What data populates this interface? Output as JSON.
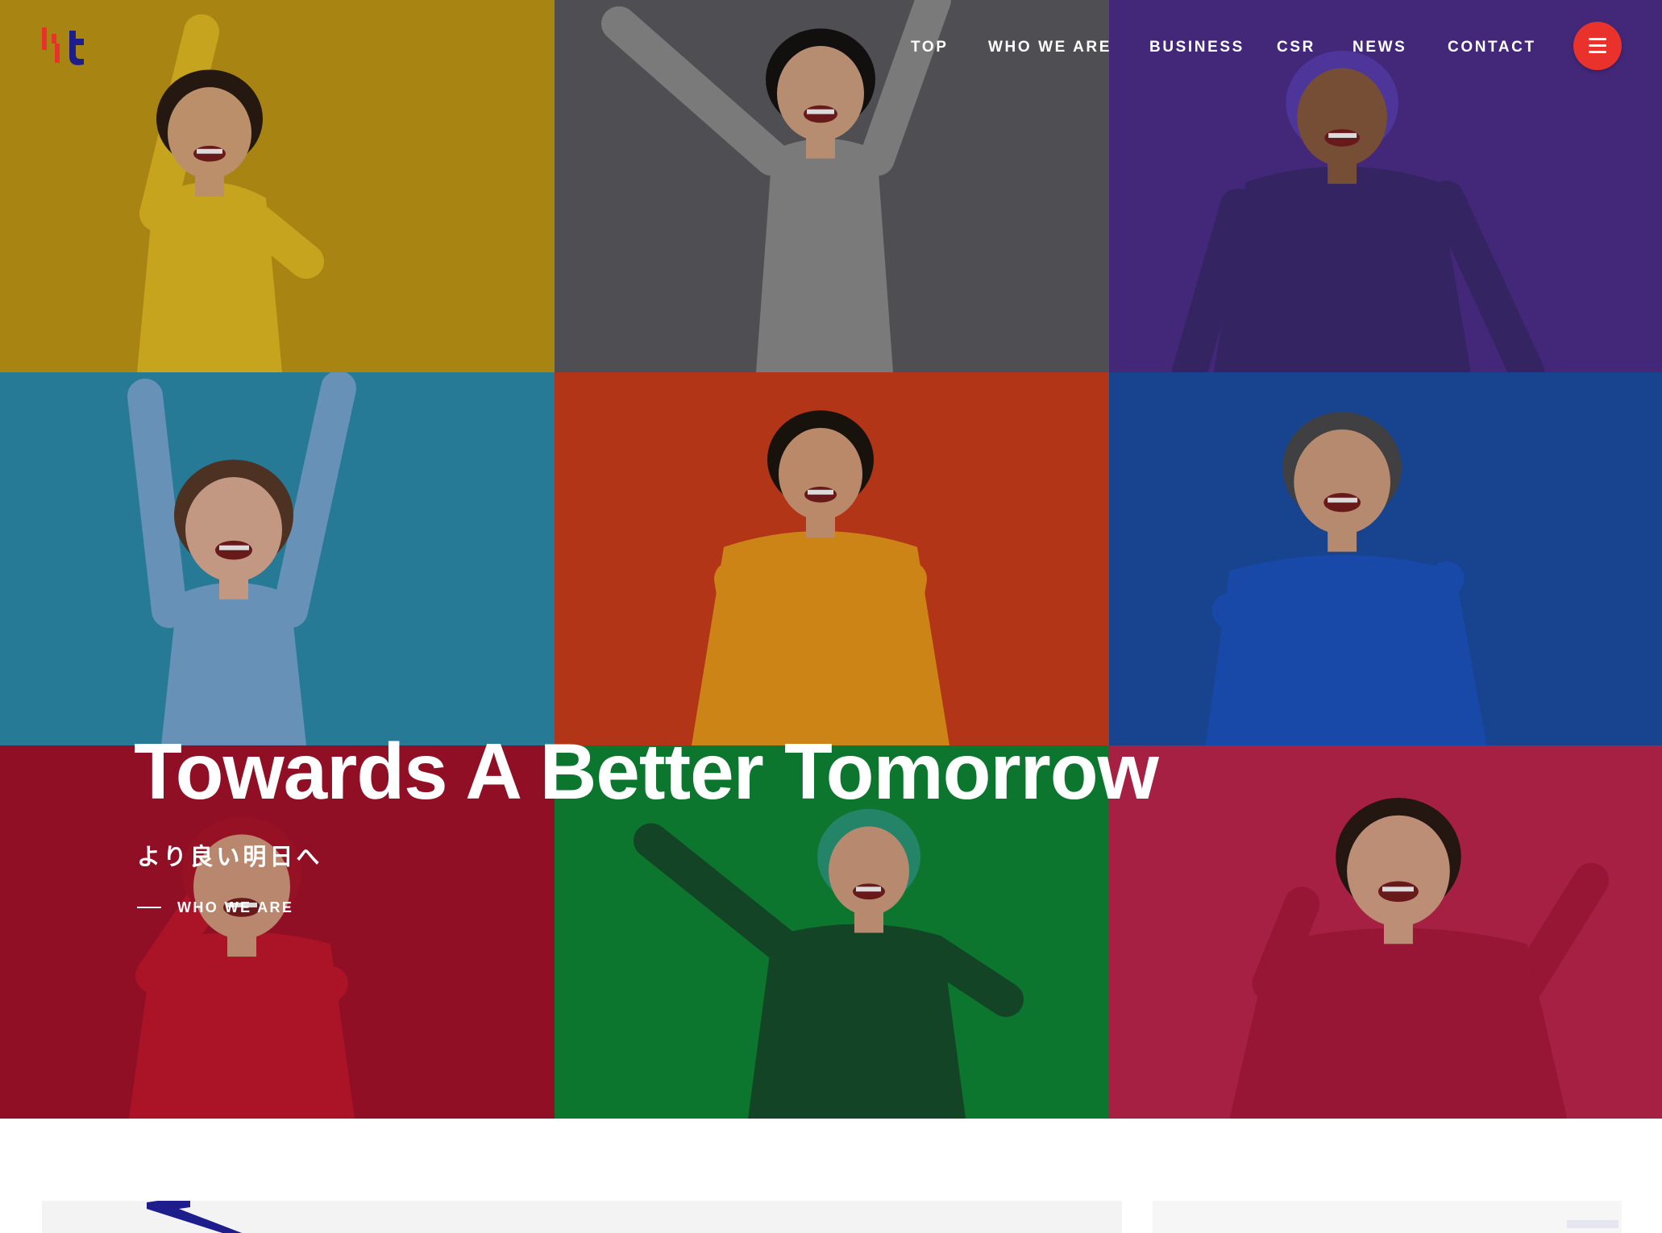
{
  "brand": {
    "logo_name": "company-logo"
  },
  "nav": {
    "items": [
      {
        "id": "top",
        "label": "TOP"
      },
      {
        "id": "who",
        "label": "WHO WE ARE"
      },
      {
        "id": "business",
        "label": "BUSINESS"
      },
      {
        "id": "csr",
        "label": "CSR"
      },
      {
        "id": "news",
        "label": "NEWS"
      },
      {
        "id": "contact",
        "label": "CONTACT"
      }
    ],
    "menu_icon": "hamburger-icon"
  },
  "hero": {
    "title": "Towards A Better Tomorrow",
    "subtitle": "より良い明日へ",
    "link_label": "WHO WE ARE",
    "tiles": [
      {
        "name": "child-yellow",
        "bg": "#c49a16",
        "figure": "#e8bf22",
        "skin": "#d9a77b",
        "hair": "#2a1c14"
      },
      {
        "name": "woman-gray",
        "bg": "#5d5d61",
        "figure": "#8e8e90",
        "skin": "#d6a585",
        "hair": "#151212"
      },
      {
        "name": "man-purple",
        "bg": "#4f2f8e",
        "figure": "#3d2c73",
        "skin": "#8a5b3e",
        "hair": "#5a3eb4"
      },
      {
        "name": "woman-teal",
        "bg": "#2d8fae",
        "figure": "#79a9d6",
        "skin": "#e3b299",
        "hair": "#5a3a28"
      },
      {
        "name": "man-orange",
        "bg": "#cf3e1a",
        "figure": "#ee9a1b",
        "skin": "#d9a07c",
        "hair": "#1c1510"
      },
      {
        "name": "man-blue",
        "bg": "#1c4ea6",
        "figure": "#1d55c4",
        "skin": "#d3a182",
        "hair": "#4b4a4c"
      },
      {
        "name": "man-red",
        "bg": "#a8122c",
        "figure": "#c8172e",
        "skin": "#d79e7f",
        "hair": "#b0142a"
      },
      {
        "name": "boy-green",
        "bg": "#108a36",
        "figure": "#17502c",
        "skin": "#d6a182",
        "hair": "#2a9a78"
      },
      {
        "name": "woman-pink",
        "bg": "#c0264f",
        "figure": "#b0193e",
        "skin": "#dba68a",
        "hair": "#2a1a14"
      }
    ]
  },
  "colors": {
    "accent": "#e8322b",
    "logo_red": "#e8322b",
    "logo_navy": "#1d1e8c"
  }
}
